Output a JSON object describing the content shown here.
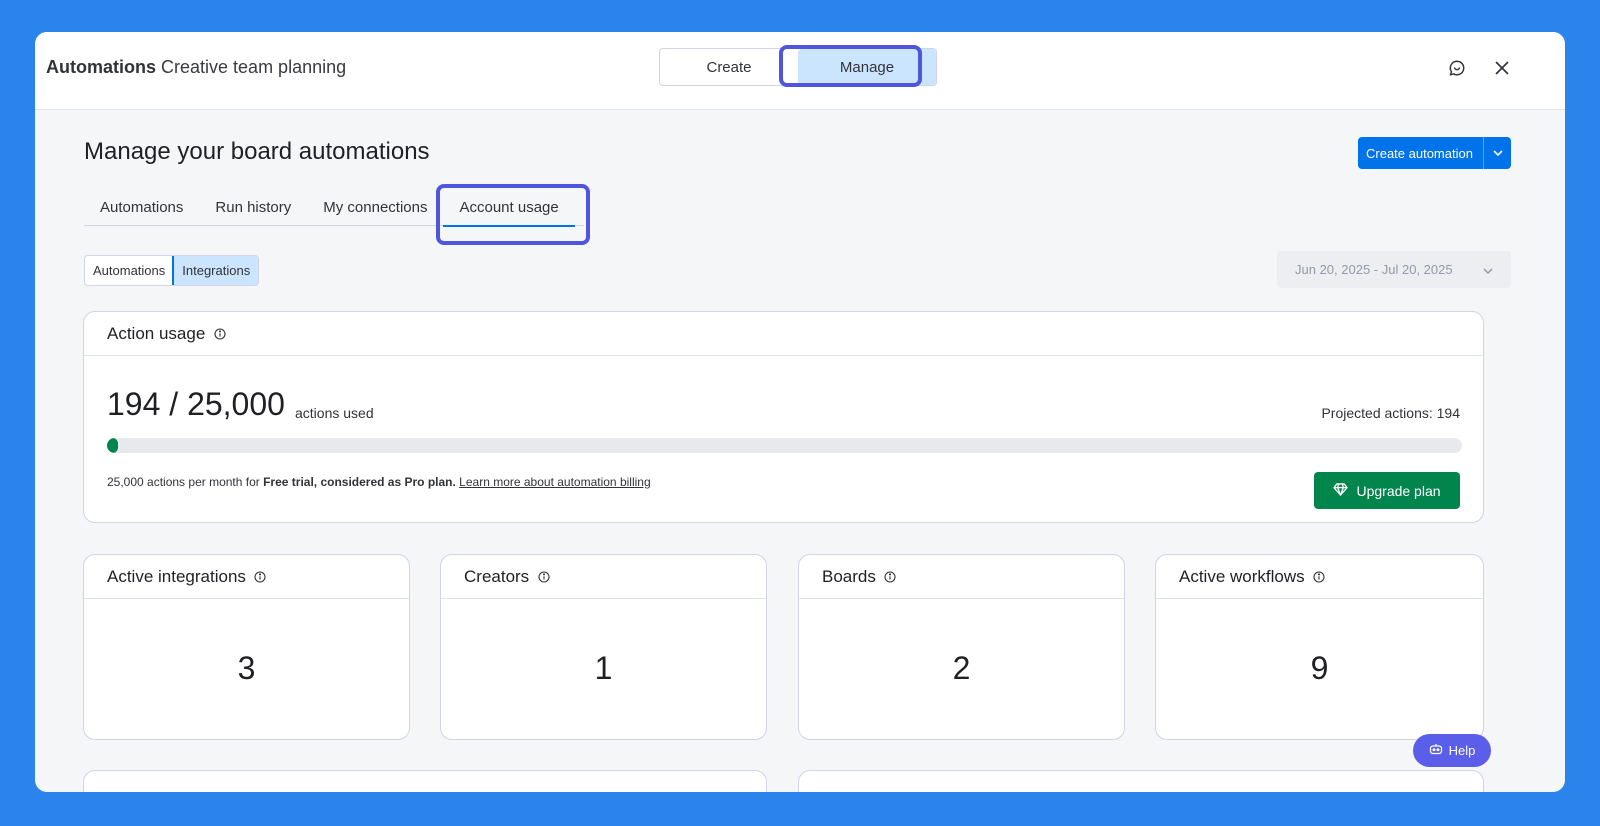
{
  "header": {
    "title_bold": "Automations",
    "title_rest": "Creative team planning",
    "segments": [
      {
        "label": "Create"
      },
      {
        "label": "Manage"
      }
    ]
  },
  "page": {
    "title": "Manage your board automations",
    "create_button": "Create automation"
  },
  "tabs": [
    {
      "label": "Automations"
    },
    {
      "label": "Run history"
    },
    {
      "label": "My connections"
    },
    {
      "label": "Account usage"
    }
  ],
  "subsegments": [
    {
      "label": "Automations"
    },
    {
      "label": "Integrations"
    }
  ],
  "date_range": "Jun 20, 2025 - Jul 20, 2025",
  "action_usage": {
    "title": "Action usage",
    "used": "194 / 25,000",
    "used_suffix": "actions used",
    "projected": "Projected actions: 194",
    "progress_fraction": 0.00776,
    "note_prefix": "25,000 actions per month for ",
    "note_bold": "Free trial, considered as Pro plan.",
    "note_link": "Learn more about automation billing",
    "upgrade_label": "Upgrade plan"
  },
  "stats": [
    {
      "title": "Active integrations",
      "value": "3"
    },
    {
      "title": "Creators",
      "value": "1"
    },
    {
      "title": "Boards",
      "value": "2"
    },
    {
      "title": "Active workflows",
      "value": "9"
    }
  ],
  "help_label": "Help",
  "colors": {
    "accent": "#0073ea",
    "success": "#00854d",
    "highlight": "#4f55dc",
    "background": "#2a84ec"
  }
}
